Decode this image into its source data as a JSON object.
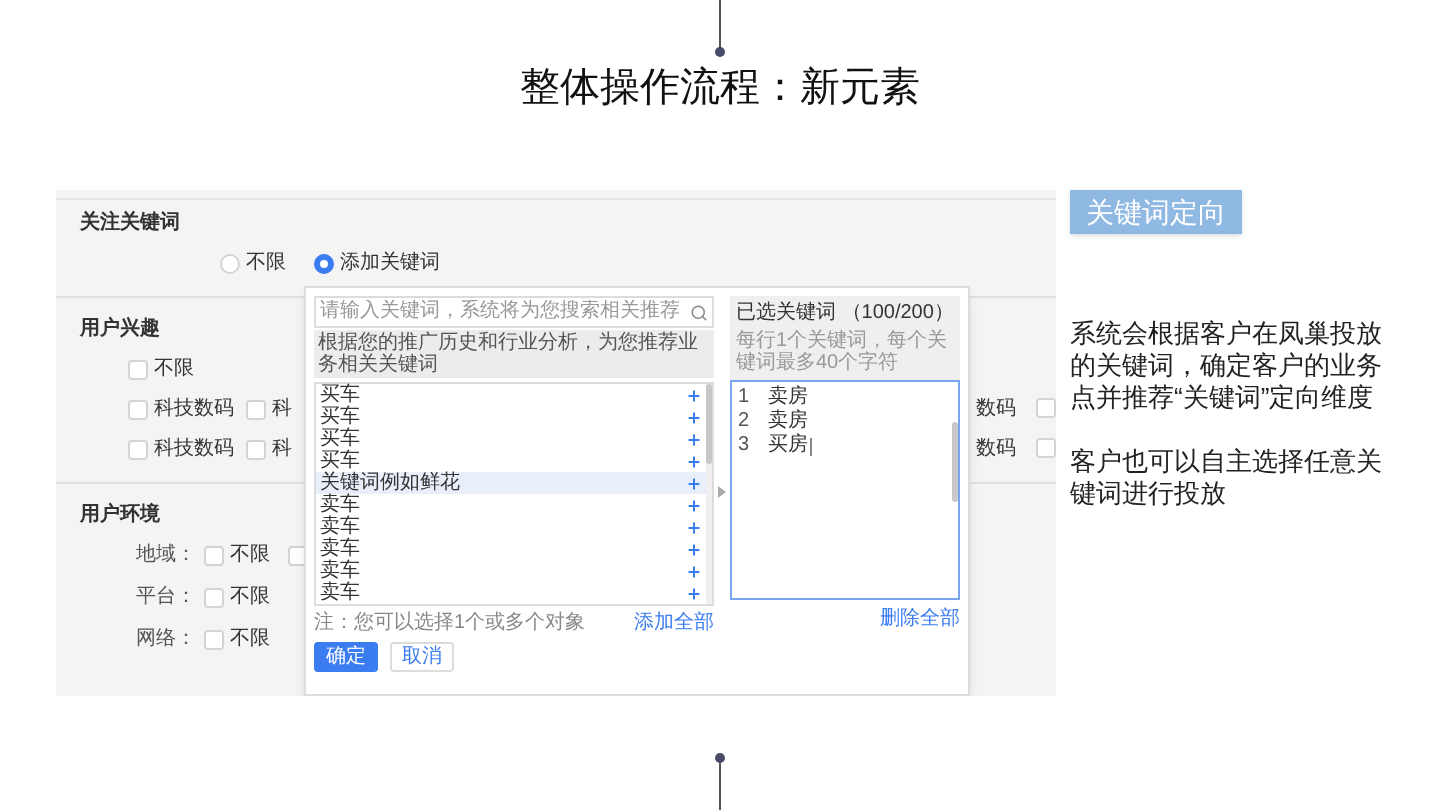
{
  "title": "整体操作流程：新元素",
  "keyword_section": {
    "heading": "关注关键词",
    "options": [
      {
        "label": "不限",
        "selected": false
      },
      {
        "label": "添加关键词",
        "selected": true
      }
    ]
  },
  "interest_section": {
    "heading": "用户兴趣",
    "rows": [
      {
        "items": [
          {
            "label": "不限",
            "checked": false
          }
        ]
      },
      {
        "items": [
          {
            "label": "科技数码",
            "checked": false
          },
          {
            "label": "科",
            "checked": false
          }
        ],
        "trailing_label": "数码",
        "trailing_checked": false
      },
      {
        "items": [
          {
            "label": "科技数码",
            "checked": false
          },
          {
            "label": "科",
            "checked": false
          }
        ],
        "trailing_label": "数码",
        "trailing_checked": false
      }
    ]
  },
  "environment_section": {
    "heading": "用户环境",
    "rows": [
      {
        "label": "地域：",
        "options": [
          {
            "label": "不限",
            "checked": false
          },
          {
            "checked": false
          }
        ]
      },
      {
        "label": "平台：",
        "options": [
          {
            "label": "不限",
            "checked": false
          }
        ]
      },
      {
        "label": "网络：",
        "options": [
          {
            "label": "不限",
            "checked": false
          }
        ]
      }
    ]
  },
  "popup": {
    "search": {
      "placeholder": "请输入关键词，系统将为您搜索相关推荐"
    },
    "hint": "根据您的推广历史和行业分析，为您推荐业务相关关键词",
    "suggestions": [
      {
        "label": "买车",
        "selected": false
      },
      {
        "label": "买车",
        "selected": false
      },
      {
        "label": "买车",
        "selected": false
      },
      {
        "label": "买车",
        "selected": false
      },
      {
        "label": "关键词例如鲜花",
        "selected": true
      },
      {
        "label": "卖车",
        "selected": false
      },
      {
        "label": "卖车",
        "selected": false
      },
      {
        "label": "卖车",
        "selected": false
      },
      {
        "label": "卖车",
        "selected": false
      },
      {
        "label": "卖车",
        "selected": false
      }
    ],
    "note": "注：您可以选择1个或多个对象",
    "add_all": "添加全部",
    "confirm": "确定",
    "cancel": "取消",
    "selected_panel": {
      "title": "已选关键词 （100/200）",
      "hint": "每行1个关键词，每个关键词最多40个字符",
      "lines": [
        {
          "number": "1",
          "text": "卖房",
          "cursor": false
        },
        {
          "number": "2",
          "text": "卖房",
          "cursor": false
        },
        {
          "number": "3",
          "text": "买房",
          "cursor": true
        }
      ],
      "delete_all": "删除全部"
    }
  },
  "tag": "关键词定向",
  "paragraphs": [
    "系统会根据客户在凤巢投放的关键词，确定客户的业务点并推荐“关键词”定向维度",
    "客户也可以自主选择任意关键词进行投放"
  ]
}
